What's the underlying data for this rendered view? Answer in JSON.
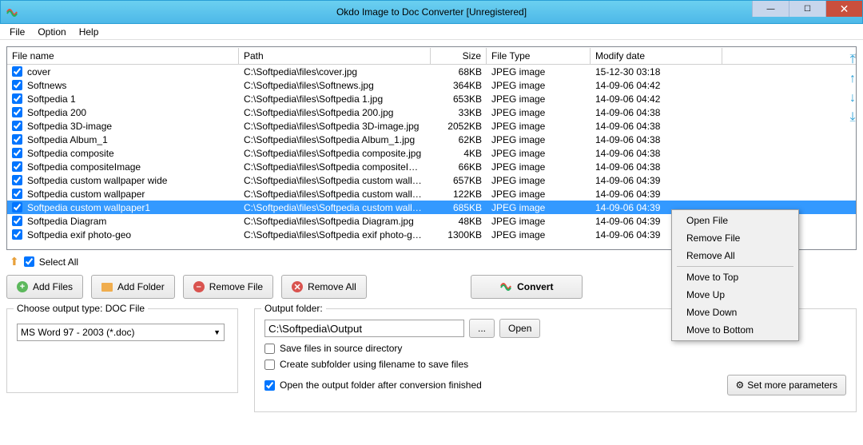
{
  "window": {
    "title": "Okdo Image to Doc Converter [Unregistered]"
  },
  "menu": {
    "file": "File",
    "option": "Option",
    "help": "Help"
  },
  "columns": {
    "name": "File name",
    "path": "Path",
    "size": "Size",
    "type": "File Type",
    "date": "Modify date"
  },
  "rows": [
    {
      "name": "cover",
      "path": "C:\\Softpedia\\files\\cover.jpg",
      "size": "68KB",
      "type": "JPEG image",
      "date": "15-12-30 03:18"
    },
    {
      "name": "Softnews",
      "path": "C:\\Softpedia\\files\\Softnews.jpg",
      "size": "364KB",
      "type": "JPEG image",
      "date": "14-09-06 04:42"
    },
    {
      "name": "Softpedia 1",
      "path": "C:\\Softpedia\\files\\Softpedia 1.jpg",
      "size": "653KB",
      "type": "JPEG image",
      "date": "14-09-06 04:42"
    },
    {
      "name": "Softpedia 200",
      "path": "C:\\Softpedia\\files\\Softpedia 200.jpg",
      "size": "33KB",
      "type": "JPEG image",
      "date": "14-09-06 04:38"
    },
    {
      "name": "Softpedia 3D-image",
      "path": "C:\\Softpedia\\files\\Softpedia 3D-image.jpg",
      "size": "2052KB",
      "type": "JPEG image",
      "date": "14-09-06 04:38"
    },
    {
      "name": "Softpedia Album_1",
      "path": "C:\\Softpedia\\files\\Softpedia Album_1.jpg",
      "size": "62KB",
      "type": "JPEG image",
      "date": "14-09-06 04:38"
    },
    {
      "name": "Softpedia composite",
      "path": "C:\\Softpedia\\files\\Softpedia composite.jpg",
      "size": "4KB",
      "type": "JPEG image",
      "date": "14-09-06 04:38"
    },
    {
      "name": "Softpedia compositeImage",
      "path": "C:\\Softpedia\\files\\Softpedia compositeImag...",
      "size": "66KB",
      "type": "JPEG image",
      "date": "14-09-06 04:38"
    },
    {
      "name": "Softpedia custom wallpaper wide",
      "path": "C:\\Softpedia\\files\\Softpedia custom wallpa...",
      "size": "657KB",
      "type": "JPEG image",
      "date": "14-09-06 04:39"
    },
    {
      "name": "Softpedia custom wallpaper",
      "path": "C:\\Softpedia\\files\\Softpedia custom wallpa...",
      "size": "122KB",
      "type": "JPEG image",
      "date": "14-09-06 04:39"
    },
    {
      "name": "Softpedia custom wallpaper1",
      "path": "C:\\Softpedia\\files\\Softpedia custom wallpa...",
      "size": "685KB",
      "type": "JPEG image",
      "date": "14-09-06 04:39",
      "selected": true
    },
    {
      "name": "Softpedia Diagram",
      "path": "C:\\Softpedia\\files\\Softpedia Diagram.jpg",
      "size": "48KB",
      "type": "JPEG image",
      "date": "14-09-06 04:39"
    },
    {
      "name": "Softpedia exif photo-geo",
      "path": "C:\\Softpedia\\files\\Softpedia exif photo-geo.j...",
      "size": "1300KB",
      "type": "JPEG image",
      "date": "14-09-06 04:39"
    }
  ],
  "select_all": "Select All",
  "buttons": {
    "add_files": "Add Files",
    "add_folder": "Add Folder",
    "remove_file": "Remove File",
    "remove_all": "Remove All",
    "convert": "Convert"
  },
  "output_type": {
    "label": "Choose output type:  DOC File",
    "value": "MS Word 97 - 2003 (*.doc)"
  },
  "output_folder": {
    "label": "Output folder:",
    "value": "C:\\Softpedia\\Output",
    "browse": "...",
    "open": "Open",
    "cb_source": "Save files in source directory",
    "cb_subfolder": "Create subfolder using filename to save files",
    "cb_openafter": "Open the output folder after conversion finished",
    "set_more": "Set more parameters"
  },
  "context": {
    "open_file": "Open File",
    "remove_file": "Remove File",
    "remove_all": "Remove All",
    "move_top": "Move to Top",
    "move_up": "Move Up",
    "move_down": "Move Down",
    "move_bottom": "Move to Bottom"
  }
}
